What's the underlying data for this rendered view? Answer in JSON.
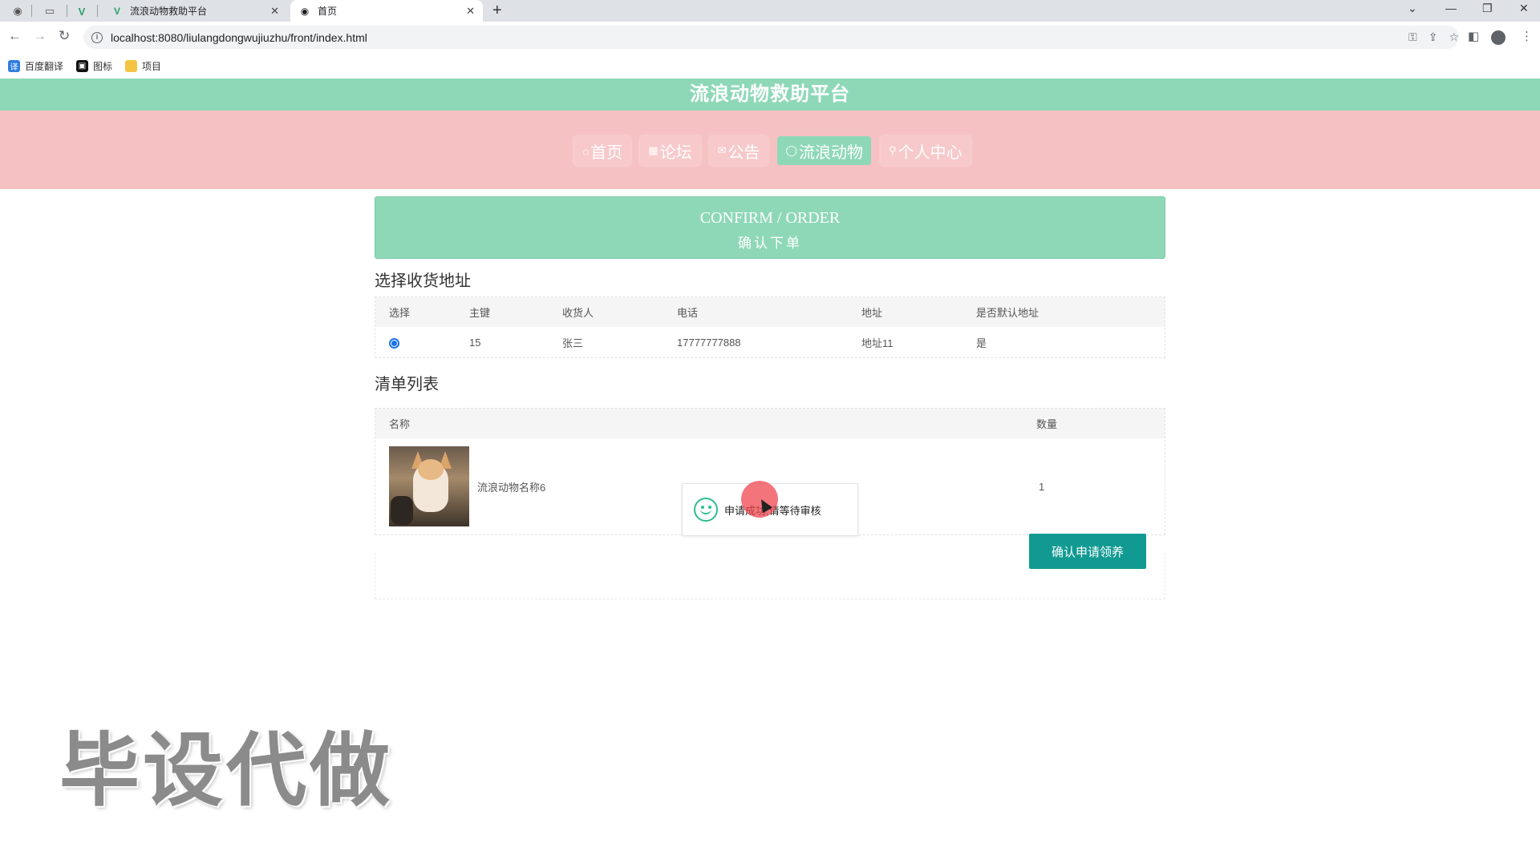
{
  "browser": {
    "tabs": [
      {
        "title": "流浪动物救助平台",
        "active": false
      },
      {
        "title": "首页",
        "active": true
      }
    ],
    "url": "localhost:8080/liulangdongwujiuzhu/front/index.html",
    "bookmarks": [
      "百度翻译",
      "图标",
      "项目"
    ]
  },
  "site": {
    "title": "流浪动物救助平台",
    "nav": [
      {
        "label": "首页",
        "icon": "⌂",
        "active": false
      },
      {
        "label": "论坛",
        "icon": "▦",
        "active": false
      },
      {
        "label": "公告",
        "icon": "✉",
        "active": false
      },
      {
        "label": "流浪动物",
        "icon": "◯",
        "active": true
      },
      {
        "label": "个人中心",
        "icon": "⚲",
        "active": false
      }
    ]
  },
  "banner": {
    "en": "CONFIRM / ORDER",
    "cn": "确认下单"
  },
  "address": {
    "heading": "选择收货地址",
    "columns": [
      "选择",
      "主键",
      "收货人",
      "电话",
      "地址",
      "是否默认地址"
    ],
    "rows": [
      {
        "id": "15",
        "name": "张三",
        "phone": "17777777888",
        "address": "地址11",
        "default": "是"
      }
    ]
  },
  "orderlist": {
    "heading": "清单列表",
    "col_name": "名称",
    "col_qty": "数量",
    "items": [
      {
        "name": "流浪动物名称6",
        "qty": "1"
      }
    ]
  },
  "confirm_button": "确认申请领养",
  "toast": {
    "message": "申请成功,请等待审核"
  },
  "watermark": "毕设代做"
}
